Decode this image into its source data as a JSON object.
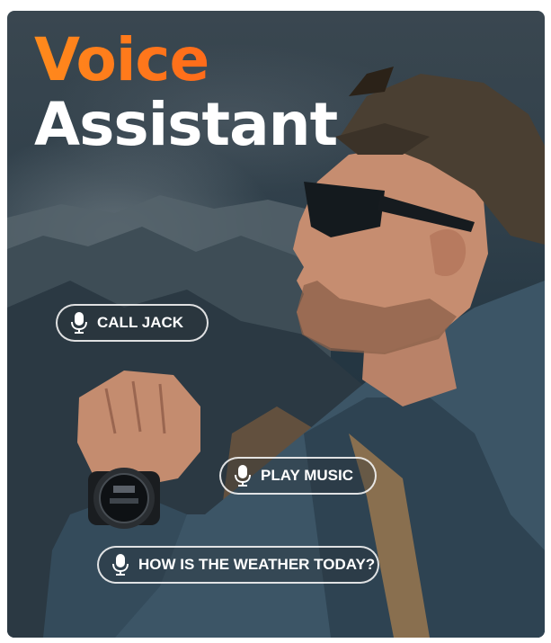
{
  "headline": {
    "line1": "Voice",
    "line2": "Assistant"
  },
  "commands": [
    {
      "icon": "microphone-icon",
      "label": "CALL JACK"
    },
    {
      "icon": "microphone-icon",
      "label": "PLAY MUSIC"
    },
    {
      "icon": "microphone-icon",
      "label": "HOW IS THE WEATHER TODAY?"
    }
  ],
  "colors": {
    "headline_accent": "#ff6a1a",
    "headline_primary": "#ffffff",
    "pill_border": "#ffffff"
  }
}
